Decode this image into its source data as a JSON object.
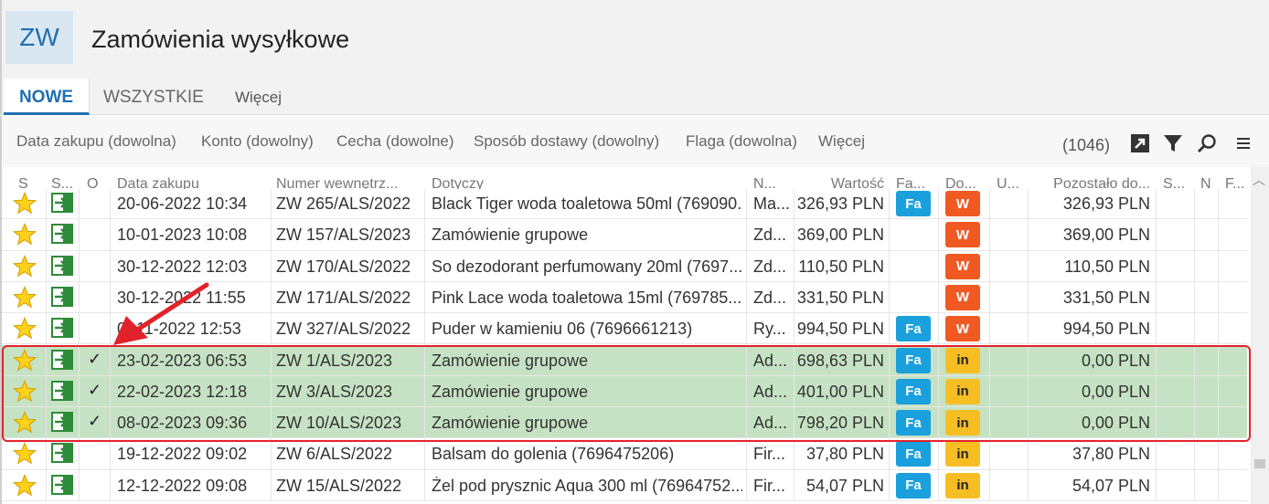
{
  "app": {
    "logo": "ZW",
    "title": "Zamówienia wysyłkowe"
  },
  "tabs": [
    "NOWE",
    "WSZYSTKIE",
    "Więcej"
  ],
  "filters": [
    "Data zakupu (dowolna)",
    "Konto (dowolny)",
    "Cecha (dowolne)",
    "Sposób dostawy (dowolny)",
    "Flaga (dowolna)",
    "Więcej"
  ],
  "toolbar": {
    "count": "(1046)",
    "icons": [
      "export-icon",
      "filter-icon",
      "search-icon",
      "menu-icon"
    ]
  },
  "columns": [
    "S",
    "S...",
    "O",
    "Data zakupu",
    "Numer wewnętrz...",
    "Dotyczy",
    "N...",
    "Wartość",
    "Fa...",
    "Do...",
    "U...",
    "Pozostało do...",
    "S...",
    "N",
    "F..."
  ],
  "rows": [
    {
      "date": "20-06-2022 10:34",
      "number": "ZW 265/ALS/2022",
      "subject": "Black Tiger woda toaletowa 50ml (769090...",
      "n": "Ma...",
      "value": "326,93 PLN",
      "fa": "Fa",
      "doc": "W",
      "remaining": "326,93 PLN",
      "check": "",
      "selected": false
    },
    {
      "date": "10-01-2023 10:08",
      "number": "ZW 157/ALS/2023",
      "subject": "Zamówienie grupowe",
      "n": "Zd...",
      "value": "369,00 PLN",
      "fa": "",
      "doc": "W",
      "remaining": "369,00 PLN",
      "check": "",
      "selected": false
    },
    {
      "date": "30-12-2022 12:03",
      "number": "ZW 170/ALS/2022",
      "subject": "So dezodorant perfumowany 20ml (7697...",
      "n": "Zd...",
      "value": "110,50 PLN",
      "fa": "",
      "doc": "W",
      "remaining": "110,50 PLN",
      "check": "",
      "selected": false
    },
    {
      "date": "30-12-2022 11:55",
      "number": "ZW 171/ALS/2022",
      "subject": "Pink Lace woda toaletowa 15ml (769785...",
      "n": "Zd...",
      "value": "331,50 PLN",
      "fa": "",
      "doc": "W",
      "remaining": "331,50 PLN",
      "check": "",
      "selected": false
    },
    {
      "date": "0 -11-2022 12:53",
      "number": "ZW 327/ALS/2022",
      "subject": "Puder w kamieniu 06 (7696661213)",
      "n": "Ry...",
      "value": "994,50 PLN",
      "fa": "Fa",
      "doc": "W",
      "remaining": "994,50 PLN",
      "check": "",
      "selected": false
    },
    {
      "date": "23-02-2023 06:53",
      "number": "ZW 1/ALS/2023",
      "subject": "Zamówienie grupowe",
      "n": "Ad...",
      "value": "698,63 PLN",
      "fa": "Fa",
      "doc": "in",
      "remaining": "0,00 PLN",
      "check": "✓",
      "selected": true
    },
    {
      "date": "22-02-2023 12:18",
      "number": "ZW 3/ALS/2023",
      "subject": "Zamówienie grupowe",
      "n": "Ad...",
      "value": "401,00 PLN",
      "fa": "Fa",
      "doc": "in",
      "remaining": "0,00 PLN",
      "check": "✓",
      "selected": true
    },
    {
      "date": "08-02-2023 09:36",
      "number": "ZW 10/ALS/2023",
      "subject": "Zamówienie grupowe",
      "n": "Ad...",
      "value": "798,20 PLN",
      "fa": "Fa",
      "doc": "in",
      "remaining": "0,00 PLN",
      "check": "✓",
      "selected": true
    },
    {
      "date": "19-12-2022 09:02",
      "number": "ZW 6/ALS/2022",
      "subject": "Balsam do golenia (7696475206)",
      "n": "Fir...",
      "value": "37,80 PLN",
      "fa": "Fa",
      "doc": "in",
      "remaining": "37,80 PLN",
      "check": "",
      "selected": false
    },
    {
      "date": "12-12-2022 09:08",
      "number": "ZW 15/ALS/2022",
      "subject": "Żel pod prysznic Aqua 300 ml (76964752...",
      "n": "Fir...",
      "value": "54,07 PLN",
      "fa": "Fa",
      "doc": "in",
      "remaining": "54,07 PLN",
      "check": "",
      "selected": false
    }
  ],
  "colors": {
    "accent": "#1f6fb0",
    "fa_badge": "#1aa0dc",
    "w_badge": "#f05a22",
    "in_badge": "#f7be24",
    "selected_row": "#c6e2c4",
    "annotation": "#e2222b"
  }
}
